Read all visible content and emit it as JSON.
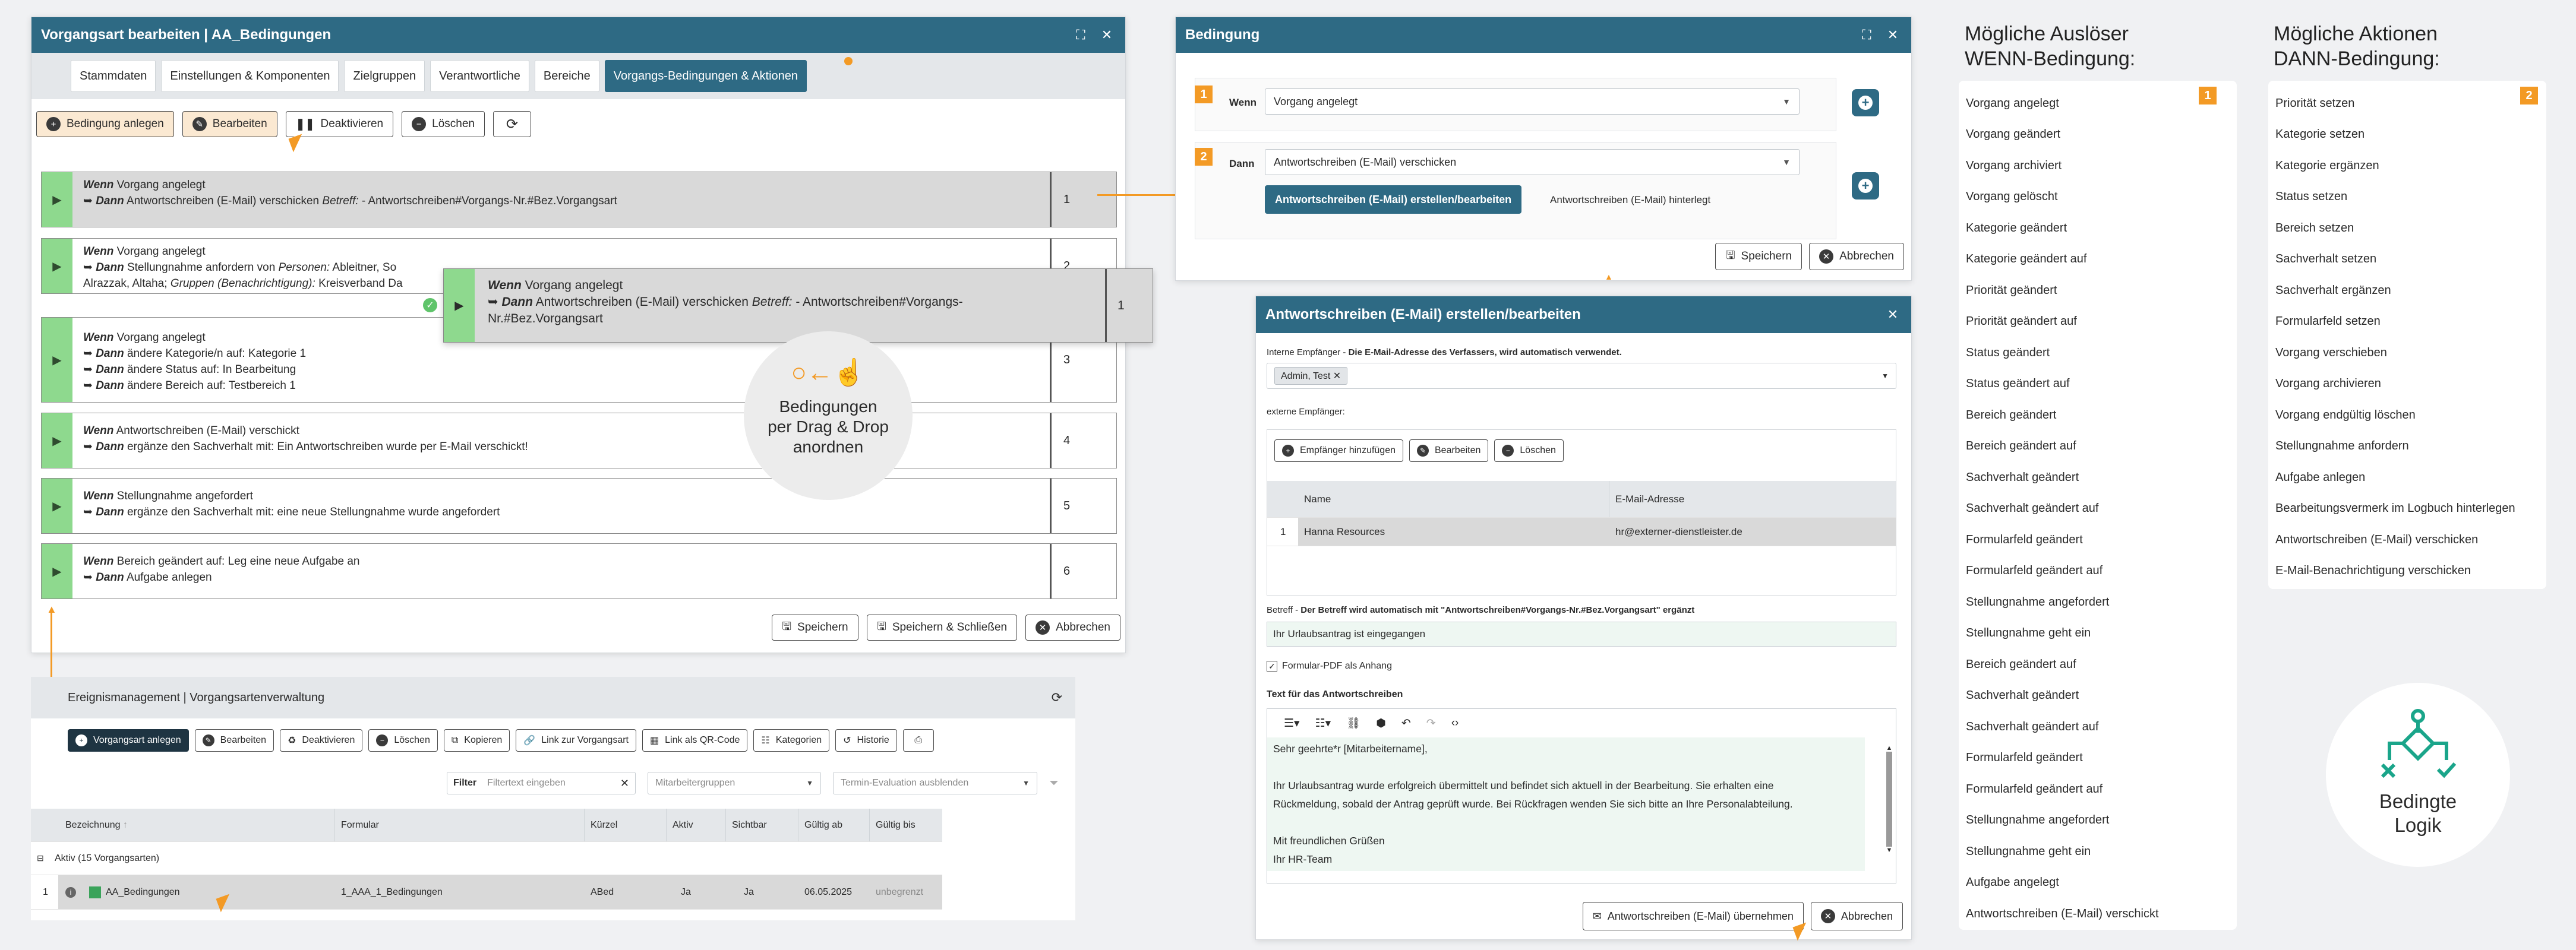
{
  "left_window": {
    "title": "Vorgangsart bearbeiten | AA_Bedingungen",
    "tabs": [
      "Stammdaten",
      "Einstellungen & Komponenten",
      "Zielgruppen",
      "Verantwortliche",
      "Bereiche",
      "Vorgangs-Bedingungen & Aktionen"
    ],
    "toolbar": {
      "add": "Bedingung anlegen",
      "edit": "Bearbeiten",
      "deactivate": "Deaktivieren",
      "delete": "Löschen"
    },
    "conditions": [
      {
        "wenn_label": "Wenn",
        "wenn": "Vorgang angelegt",
        "dann_label": "Dann",
        "dann": "Antwortschreiben (E-Mail) verschicken",
        "extra_label": "Betreff:",
        "extra": "- Antwortschreiben#Vorgangs-Nr.#Bez.Vorgangsart",
        "num": "1"
      },
      {
        "wenn": "Vorgang angelegt",
        "dann": "Stellungnahme anfordern von",
        "p_label": "Personen:",
        "p": "Ableitner, So",
        "line2": "Alrazzak, Altaha;",
        "g_label": "Gruppen (Benachrichtigung):",
        "g": "Kreisverband Da",
        "num": "2"
      },
      {
        "wenn": "Vorgang angelegt",
        "l1": "ändere Kategorie/n auf: Kategorie 1",
        "l2": "ändere Status auf: In Bearbeitung",
        "l3": "ändere Bereich auf: Testbereich 1",
        "num": "3"
      },
      {
        "wenn": "Antwortschreiben (E-Mail) verschickt",
        "dann": "ergänze den Sachverhalt mit: Ein Antwortschreiben wurde per E-Mail verschickt!",
        "num": "4"
      },
      {
        "wenn": "Stellungnahme angefordert",
        "dann": "ergänze den Sachverhalt mit: eine neue Stellungnahme wurde angefordert",
        "num": "5"
      },
      {
        "wenn": "Bereich geändert auf: Leg eine neue Aufgabe an",
        "dann": "Aufgabe anlegen",
        "num": "6"
      }
    ],
    "drag": {
      "wenn": "Vorgang angelegt",
      "dann": "Antwortschreiben (E-Mail) verschicken",
      "extra_label": "Betreff:",
      "extra": "- Antwortschreiben#Vorgangs-",
      "extra2": "Nr.#Bez.Vorgangsart",
      "num": "1"
    },
    "dnd_hint": [
      "Bedingungen",
      "per Drag & Drop",
      "anordnen"
    ],
    "footer": {
      "save": "Speichern",
      "save_close": "Speichern & Schließen",
      "cancel": "Abbrechen"
    }
  },
  "bottom_window": {
    "title": "Ereignismanagement | Vorgangsartenverwaltung",
    "toolbar": [
      "Vorgangsart anlegen",
      "Bearbeiten",
      "Deaktivieren",
      "Löschen",
      "Kopieren",
      "Link zur Vorgangsart",
      "Link als QR-Code",
      "Kategorien",
      "Historie"
    ],
    "filter_label": "Filter",
    "filter_placeholder": "Filtertext eingeben",
    "group_select": "Mitarbeitergruppen",
    "term_select": "Termin-Evaluation ausblenden",
    "columns": [
      "Bezeichnung",
      "Formular",
      "Kürzel",
      "Aktiv",
      "Sichtbar",
      "Gültig ab",
      "Gültig bis"
    ],
    "group_label": "Aktiv (15 Vorgangsarten)",
    "row": {
      "n": "1",
      "name": "AA_Bedingungen",
      "form": "1_AAA_1_Bedingungen",
      "short": "ABed",
      "active": "Ja",
      "visible": "Ja",
      "from": "06.05.2025",
      "to": "unbegrenzt"
    }
  },
  "condition_window": {
    "title": "Bedingung",
    "wenn_label": "Wenn",
    "wenn_value": "Vorgang angelegt",
    "dann_label": "Dann",
    "dann_value": "Antwortschreiben (E-Mail) verschicken",
    "create_btn": "Antwortschreiben (E-Mail) erstellen/bearbeiten",
    "stored": "Antwortschreiben (E-Mail) hinterlegt",
    "save": "Speichern",
    "cancel": "Abbrechen",
    "badges": [
      "1",
      "2"
    ]
  },
  "email_window": {
    "title": "Antwortschreiben (E-Mail) erstellen/bearbeiten",
    "internal_label": "Interne Empfänger",
    "internal_note": "Die E-Mail-Adresse des Verfassers, wird automatisch verwendet.",
    "chip": "Admin, Test",
    "external_label": "externe Empfänger:",
    "toolbar": {
      "add": "Empfänger hinzufügen",
      "edit": "Bearbeiten",
      "delete": "Löschen"
    },
    "columns": [
      "Name",
      "E-Mail-Adresse"
    ],
    "recipient": {
      "n": "1",
      "name": "Hanna Resources",
      "email": "hr@externer-dienstleister.de"
    },
    "subject_label": "Betreff",
    "subject_note": "Der Betreff wird automatisch mit \"Antwortschreiben#Vorgangs-Nr.#Bez.Vorgangsart\" ergänzt",
    "subject": "Ihr Urlaubsantrag ist eingegangen",
    "pdf_label": "Formular-PDF als Anhang",
    "text_label": "Text für das Antwortschreiben",
    "body": [
      "Sehr geehrte*r [Mitarbeitername],",
      "",
      "Ihr Urlaubsantrag wurde erfolgreich übermittelt und befindet sich aktuell in der Bearbeitung. Sie erhalten eine",
      "Rückmeldung, sobald der Antrag geprüft wurde. Bei Rückfragen wenden Sie sich bitte an Ihre Personalabteilung.",
      "",
      "Mit freundlichen Grüßen",
      "Ihr HR-Team"
    ],
    "apply": "Antwortschreiben (E-Mail) übernehmen",
    "cancel": "Abbrechen"
  },
  "triggers": {
    "heading": [
      "Mögliche Auslöser",
      "WENN-Bedingung:"
    ],
    "badge": "1",
    "items": [
      "Vorgang angelegt",
      "Vorgang geändert",
      "Vorgang archiviert",
      "Vorgang gelöscht",
      "Kategorie geändert",
      "Kategorie geändert auf",
      "Priorität geändert",
      "Priorität geändert auf",
      "Status geändert",
      "Status geändert auf",
      "Bereich geändert",
      "Bereich geändert auf",
      "Sachverhalt geändert",
      "Sachverhalt geändert auf",
      "Formularfeld geändert",
      "Formularfeld geändert auf",
      "Stellungnahme angefordert",
      "Stellungnahme geht ein",
      "Bereich geändert auf",
      "Sachverhalt geändert",
      "Sachverhalt geändert auf",
      "Formularfeld geändert",
      "Formularfeld geändert auf",
      "Stellungnahme angefordert",
      "Stellungnahme geht ein",
      "Aufgabe angelegt",
      "Antwortschreiben (E-Mail) verschickt"
    ]
  },
  "actions": {
    "heading": [
      "Mögliche Aktionen",
      "DANN-Bedingung:"
    ],
    "badge": "2",
    "items": [
      "Priorität setzen",
      "Kategorie setzen",
      "Kategorie ergänzen",
      "Status setzen",
      "Bereich setzen",
      "Sachverhalt setzen",
      "Sachverhalt ergänzen",
      "Formularfeld setzen",
      "Vorgang verschieben",
      "Vorgang archivieren",
      "Vorgang endgültig löschen",
      "Stellungnahme anfordern",
      "Aufgabe anlegen",
      "Bearbeitungsvermerk im Logbuch hinterlegen",
      "Antwortschreiben (E-Mail) verschicken",
      "E-Mail-Benachrichtigung verschicken"
    ]
  },
  "logo": {
    "text": [
      "Bedingte",
      "Logik"
    ],
    "color": "#1aa58a"
  },
  "accent": "#f39a25",
  "brand": "#2e6a84"
}
